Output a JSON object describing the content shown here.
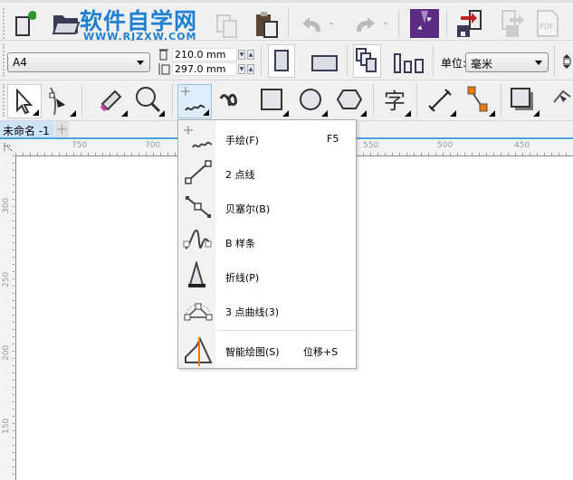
{
  "watermark": {
    "title": "软件自学网",
    "url": "WWW.RJZXW.COM"
  },
  "toolbar_standard": {
    "icons": [
      "new-document-icon",
      "open-icon",
      "copy-icon",
      "paste-icon",
      "undo-icon",
      "redo-icon",
      "corel-launcher-icon",
      "import-icon",
      "export-icon",
      "publish-pdf-icon"
    ]
  },
  "property_bar": {
    "page_size": "A4",
    "width": "210.0 mm",
    "height": "297.0 mm",
    "units_label": "单位:",
    "units_value": "毫米"
  },
  "tab": {
    "document": "未命名 -1",
    "add": "+"
  },
  "ruler": {
    "top": [
      "750",
      "700",
      "550",
      "500",
      "450"
    ],
    "left": [
      "300",
      "250",
      "200",
      "150"
    ]
  },
  "menu": {
    "items": [
      {
        "label": "手绘(F)",
        "shortcut": "F5"
      },
      {
        "label": "2 点线"
      },
      {
        "label": "贝塞尔(B)"
      },
      {
        "label": "B 样条"
      },
      {
        "label": "折线(P)"
      },
      {
        "label": "3 点曲线(3)"
      },
      {
        "label": "智能绘图(S)",
        "shortcut": "位移+S"
      }
    ]
  },
  "colors": {
    "accent": "#4aa3df",
    "logo": "#1f7fd0",
    "corel": "#5a2d82"
  }
}
